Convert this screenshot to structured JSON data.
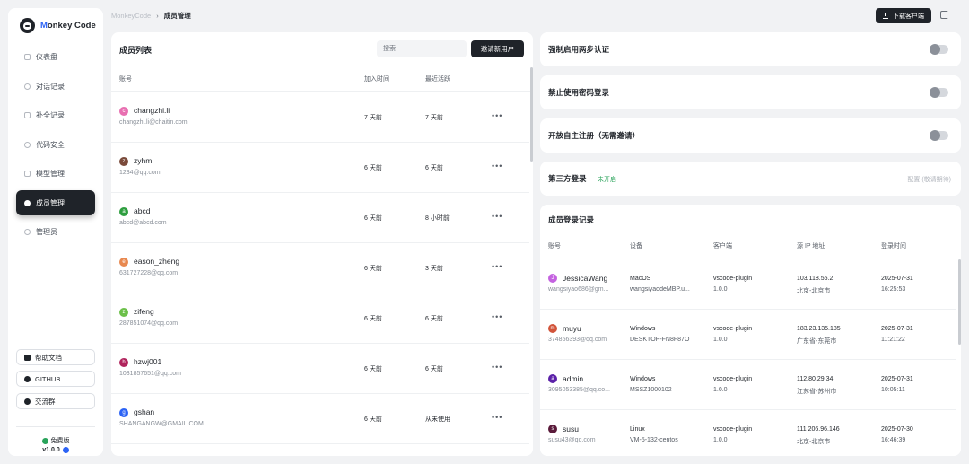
{
  "brand": {
    "name_first": "M",
    "name_rest": "onkey Code"
  },
  "sidebar": {
    "items": [
      {
        "label": "仪表盘",
        "icon": "dashboard-icon"
      },
      {
        "label": "对话记录",
        "icon": "chat-icon"
      },
      {
        "label": "补全记录",
        "icon": "completion-icon"
      },
      {
        "label": "代码安全",
        "icon": "shield-icon"
      },
      {
        "label": "模型管理",
        "icon": "model-icon"
      },
      {
        "label": "成员管理",
        "icon": "users-icon",
        "active": true
      },
      {
        "label": "管理员",
        "icon": "admin-icon"
      }
    ],
    "help_docs": "帮助文档",
    "github": "GITHUB",
    "community": "交流群",
    "edition": "免费版",
    "version": "v1.0.0"
  },
  "breadcrumb": {
    "root": "MonkeyCode",
    "separator": "›",
    "current": "成员管理"
  },
  "topbar": {
    "download_label": "下载客户端"
  },
  "members": {
    "title": "成员列表",
    "search_placeholder": "搜索",
    "invite_label": "邀请新用户",
    "columns": {
      "account": "账号",
      "joined": "加入时间",
      "last_active": "最近活跃"
    },
    "rows": [
      {
        "initial": "c",
        "color": "#e86fb1",
        "name": "changzhi.li",
        "email": "changzhi.li@chaitin.com",
        "joined": "7 天前",
        "last_active": "7 天前"
      },
      {
        "initial": "z",
        "color": "#7a4a3a",
        "name": "zyhm",
        "email": "1234@qq.com",
        "joined": "6 天前",
        "last_active": "6 天前"
      },
      {
        "initial": "a",
        "color": "#2e9e3f",
        "name": "abcd",
        "email": "abcd@abcd.com",
        "joined": "6 天前",
        "last_active": "8 小时前"
      },
      {
        "initial": "e",
        "color": "#e8884f",
        "name": "eason_zheng",
        "email": "631727228@qq.com",
        "joined": "6 天前",
        "last_active": "3 天前"
      },
      {
        "initial": "z",
        "color": "#6cc04a",
        "name": "zifeng",
        "email": "287851074@qq.com",
        "joined": "6 天前",
        "last_active": "6 天前"
      },
      {
        "initial": "h",
        "color": "#b0235c",
        "name": "hzwj001",
        "email": "1031857651@qq.com",
        "joined": "6 天前",
        "last_active": "6 天前"
      },
      {
        "initial": "g",
        "color": "#2c63f5",
        "name": "gshan",
        "email": "SHANGANGW@GMAIL.COM",
        "joined": "6 天前",
        "last_active": "从未使用"
      }
    ],
    "more_label": "•••"
  },
  "settings": {
    "two_factor": "强制启用两步认证",
    "disable_password": "禁止使用密码登录",
    "open_register": "开放自主注册（无需邀请）",
    "third_party": {
      "label": "第三方登录",
      "status": "未开启",
      "config": "配置 (敬请期待)"
    }
  },
  "records": {
    "title": "成员登录记录",
    "columns": {
      "account": "账号",
      "device": "设备",
      "client": "客户端",
      "ip": "源 IP 地址",
      "time": "登录时间"
    },
    "rows": [
      {
        "initial": "J",
        "color": "#c462e0",
        "name": "JessicaWang",
        "email": "wangsiyao686@gm...",
        "os": "MacOS",
        "host": "wangsiyaodeMBP.u...",
        "client": "vscode-plugin",
        "client_ver": "1.0.0",
        "ip": "103.118.55.2",
        "loc": "北京-北京市",
        "date": "2025-07-31",
        "time": "16:25:53"
      },
      {
        "initial": "m",
        "color": "#d2543a",
        "name": "muyu",
        "email": "374856393@qq.com",
        "os": "Windows",
        "host": "DESKTOP-FN8F87O",
        "client": "vscode-plugin",
        "client_ver": "1.0.0",
        "ip": "183.23.135.185",
        "loc": "广东省-东莞市",
        "date": "2025-07-31",
        "time": "11:21:22"
      },
      {
        "initial": "a",
        "color": "#5b21a8",
        "name": "admin",
        "email": "3095053385@qq.co...",
        "os": "Windows",
        "host": "MSSZ1000102",
        "client": "vscode-plugin",
        "client_ver": "1.0.0",
        "ip": "112.80.29.34",
        "loc": "江苏省-苏州市",
        "date": "2025-07-31",
        "time": "10:05:11"
      },
      {
        "initial": "s",
        "color": "#5a1a3a",
        "name": "susu",
        "email": "susu43@qq.com",
        "os": "Linux",
        "host": "VM-5-132-centos",
        "client": "vscode-plugin",
        "client_ver": "1.0.0",
        "ip": "111.206.96.146",
        "loc": "北京-北京市",
        "date": "2025-07-30",
        "time": "16:46:39"
      }
    ]
  }
}
